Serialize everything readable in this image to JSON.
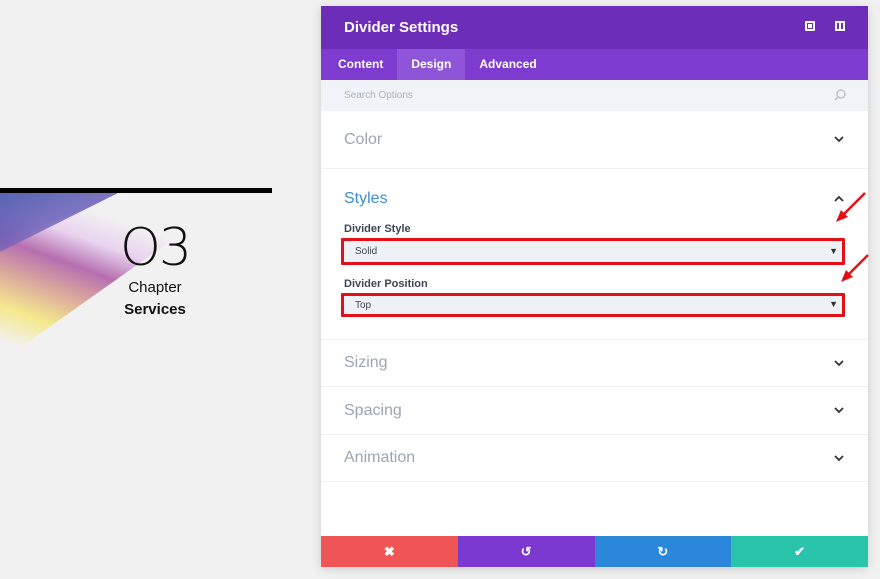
{
  "preview": {
    "chapter_number": "O3",
    "chapter_word": "Chapter",
    "chapter_title": "Services"
  },
  "panel": {
    "title": "Divider Settings",
    "tabs": [
      {
        "label": "Content",
        "active": false
      },
      {
        "label": "Design",
        "active": true
      },
      {
        "label": "Advanced",
        "active": false
      }
    ],
    "search": {
      "placeholder": "Search Options"
    },
    "sections": {
      "color": "Color",
      "styles": "Styles",
      "sizing": "Sizing",
      "spacing": "Spacing",
      "animation": "Animation"
    },
    "fields": {
      "divider_style": {
        "label": "Divider Style",
        "value": "Solid"
      },
      "divider_position": {
        "label": "Divider Position",
        "value": "Top"
      }
    },
    "footer": {
      "cancel": "✖",
      "undo": "↺",
      "redo": "↻",
      "save": "✔"
    }
  },
  "colors": {
    "header": "#6c2eb9",
    "tabs": "#7d3bcf",
    "active_tab": "#8f55d8",
    "accent_blue": "#3e8fcf",
    "highlight_red": "#e41017",
    "cancel": "#ef5555",
    "undo": "#7b39cf",
    "redo": "#2b87da",
    "save": "#29c4a9"
  }
}
